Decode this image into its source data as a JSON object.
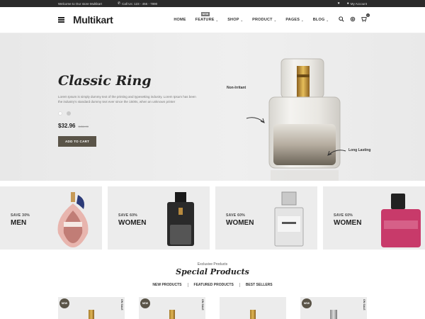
{
  "topbar": {
    "welcome": "Welcome to Our store Multikart",
    "phone": "Call Us: 123 - 456 - 7890",
    "account": "My Account"
  },
  "header": {
    "logo": {
      "m": "M",
      "rest": "ultikart"
    },
    "nav": [
      {
        "label": "HOME",
        "has_chevron": false
      },
      {
        "label": "FEATURE",
        "has_chevron": true,
        "badge": "NEW"
      },
      {
        "label": "SHOP",
        "has_chevron": true
      },
      {
        "label": "PRODUCT",
        "has_chevron": true
      },
      {
        "label": "PAGES",
        "has_chevron": true
      },
      {
        "label": "BLOG",
        "has_chevron": true
      }
    ],
    "cart_count": "0"
  },
  "hero": {
    "title": "Classic Ring",
    "description": "Lorem Ipsum is simply dummy text of the printing and typesetting industry. Lorem Ipsum has been the industry's standard dummy text ever since the 1500s, when an unknown printer",
    "colors": [
      "#ffffff",
      "#c8c8c8"
    ],
    "price": "$32.96",
    "old_price": "$456.00",
    "button": "ADD TO CART",
    "callout_left": "Non-Irritant",
    "callout_right": "Long Lasting"
  },
  "categories": [
    {
      "sub": "SAVE 30%",
      "main": "MEN"
    },
    {
      "sub": "SAVE 60%",
      "main": "WOMEN"
    },
    {
      "sub": "SAVE 60%",
      "main": "WOMEN"
    },
    {
      "sub": "SAVE 60%",
      "main": "WOMEN"
    }
  ],
  "special": {
    "kicker": "Exclusive Products",
    "title": "Special Products",
    "tabs": [
      "NEW PRODUCTS",
      "FEATURED PRODUCTS",
      "BEST SELLERS"
    ]
  },
  "products": [
    {
      "new": "NEW",
      "sale": "ON SALE"
    },
    {
      "new": "NEW",
      "sale": "ON SALE"
    },
    {
      "new": "",
      "sale": ""
    },
    {
      "new": "NEW",
      "sale": "ON SALE"
    }
  ],
  "colors": {
    "accent": "#5a5448",
    "topbar": "#2b2b2b"
  }
}
